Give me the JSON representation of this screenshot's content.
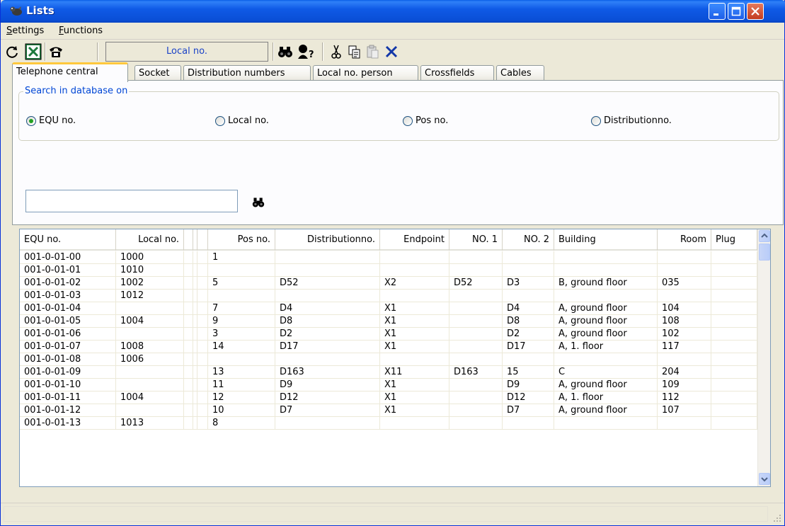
{
  "window": {
    "title": "Lists"
  },
  "menu": [
    {
      "first": "S",
      "rest": "ettings"
    },
    {
      "first": "F",
      "rest": "unctions"
    }
  ],
  "toolbar": {
    "field_label": "Local no."
  },
  "tabs": [
    {
      "label": "Telephone central",
      "active": true
    },
    {
      "label": "Socket",
      "active": false
    },
    {
      "label": "Distribution numbers",
      "active": false
    },
    {
      "label": "Local no. person",
      "active": false
    },
    {
      "label": "Crossfields",
      "active": false
    },
    {
      "label": "Cables",
      "active": false
    }
  ],
  "search": {
    "legend": "Search in database on",
    "options": [
      {
        "label": "EQU no.",
        "checked": true
      },
      {
        "label": "Local no.",
        "checked": false
      },
      {
        "label": "Pos no.",
        "checked": false
      },
      {
        "label": "Distributionno.",
        "checked": false
      }
    ],
    "value": "",
    "placeholder": ""
  },
  "grid": {
    "columns": [
      "EQU no.",
      "Local no.",
      "",
      "",
      "",
      "Pos no.",
      "Distributionno.",
      "Endpoint",
      "NO. 1",
      "NO. 2",
      "Building",
      "Room",
      "Plug"
    ],
    "rows": [
      [
        "001-0-01-00",
        "1000",
        "",
        "",
        "",
        "1",
        "",
        "",
        "",
        "",
        "",
        "",
        ""
      ],
      [
        "001-0-01-01",
        "1010",
        "",
        "",
        "",
        "",
        "",
        "",
        "",
        "",
        "",
        "",
        ""
      ],
      [
        "001-0-01-02",
        "1002",
        "",
        "",
        "",
        "5",
        "D52",
        "X2",
        "D52",
        "D3",
        "B, ground floor",
        "035",
        ""
      ],
      [
        "001-0-01-03",
        "1012",
        "",
        "",
        "",
        "",
        "",
        "",
        "",
        "",
        "",
        "",
        ""
      ],
      [
        "001-0-01-04",
        "",
        "",
        "",
        "",
        "7",
        "D4",
        "X1",
        "",
        "D4",
        "A, ground floor",
        "104",
        ""
      ],
      [
        "001-0-01-05",
        "1004",
        "",
        "",
        "",
        "9",
        "D8",
        "X1",
        "",
        "D8",
        "A, ground floor",
        "108",
        ""
      ],
      [
        "001-0-01-06",
        "",
        "",
        "",
        "",
        "3",
        "D2",
        "X1",
        "",
        "D2",
        "A, ground floor",
        "102",
        ""
      ],
      [
        "001-0-01-07",
        "1008",
        "",
        "",
        "",
        "14",
        "D17",
        "X1",
        "",
        "D17",
        "A, 1. floor",
        "117",
        ""
      ],
      [
        "001-0-01-08",
        "1006",
        "",
        "",
        "",
        "",
        "",
        "",
        "",
        "",
        "",
        "",
        ""
      ],
      [
        "001-0-01-09",
        "",
        "",
        "",
        "",
        "13",
        "D163",
        "X11",
        "D163",
        "15",
        "C",
        "204",
        ""
      ],
      [
        "001-0-01-10",
        "",
        "",
        "",
        "",
        "11",
        "D9",
        "X1",
        "",
        "D9",
        "A, ground floor",
        "109",
        ""
      ],
      [
        "001-0-01-11",
        "1004",
        "",
        "",
        "",
        "12",
        "D12",
        "X1",
        "",
        "D12",
        "A, 1. floor",
        "112",
        ""
      ],
      [
        "001-0-01-12",
        "",
        "",
        "",
        "",
        "10",
        "D7",
        "X1",
        "",
        "D7",
        "A, ground floor",
        "107",
        ""
      ],
      [
        "001-0-01-13",
        "1013",
        "",
        "",
        "",
        "8",
        "",
        "",
        "",
        "",
        "",
        "",
        ""
      ]
    ]
  },
  "status": {
    "text": ""
  }
}
